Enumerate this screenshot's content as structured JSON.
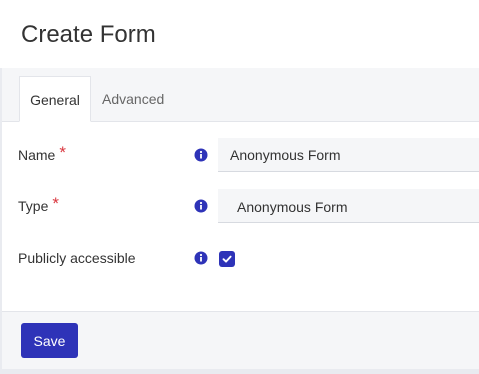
{
  "header": {
    "title": "Create Form"
  },
  "tabs": [
    {
      "label": "General",
      "active": true
    },
    {
      "label": "Advanced",
      "active": false
    }
  ],
  "form": {
    "name": {
      "label": "Name",
      "required_mark": "*",
      "value": "Anonymous Form",
      "info_icon": "info-circle-icon"
    },
    "type": {
      "label": "Type",
      "required_mark": "*",
      "value": "Anonymous Form",
      "info_icon": "info-circle-icon"
    },
    "public": {
      "label": "Publicly accessible",
      "checked": true,
      "info_icon": "info-circle-icon"
    }
  },
  "footer": {
    "save_label": "Save"
  },
  "colors": {
    "accent": "#2e33b8",
    "required": "#d9363e",
    "panel_bg": "#f5f6f8"
  }
}
